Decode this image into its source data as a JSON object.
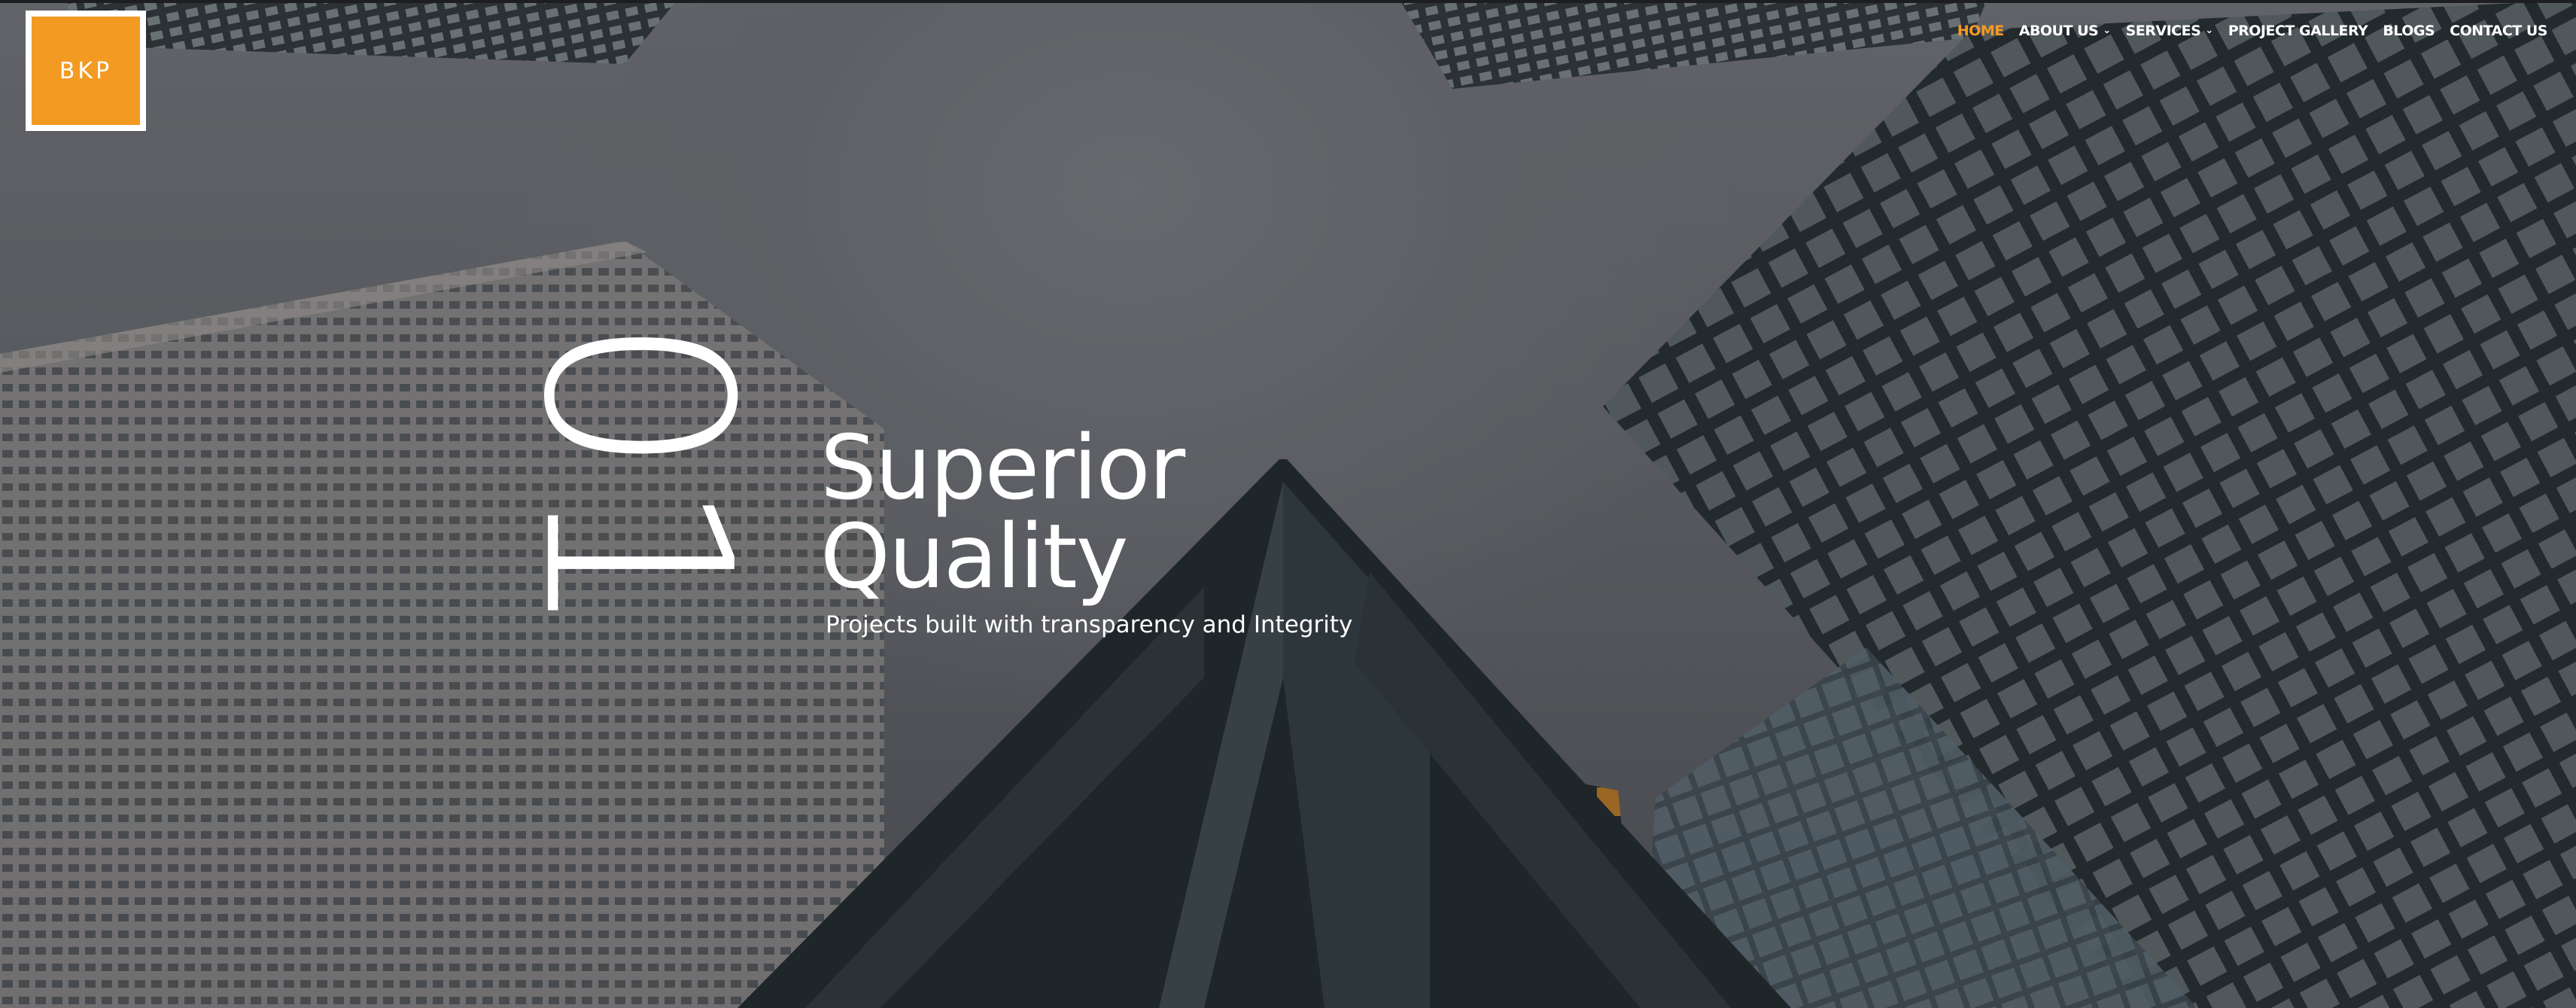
{
  "brand": {
    "logo_text": "BKP",
    "accent_color": "#f39a22"
  },
  "nav": {
    "items": [
      {
        "label": "HOME",
        "active": true,
        "has_dropdown": false
      },
      {
        "label": "ABOUT US",
        "active": false,
        "has_dropdown": true
      },
      {
        "label": "SERVICES",
        "active": false,
        "has_dropdown": true
      },
      {
        "label": "PROJECT GALLERY",
        "active": false,
        "has_dropdown": false
      },
      {
        "label": "BLOGS",
        "active": false,
        "has_dropdown": false
      },
      {
        "label": "CONTACT US",
        "active": false,
        "has_dropdown": false
      }
    ]
  },
  "hero": {
    "slide_number": "01",
    "headline_line1": "Superior",
    "headline_line2": "Quality",
    "subheadline": "Projects built with transparency and Integrity",
    "background": "skyscrapers-upward-view"
  }
}
